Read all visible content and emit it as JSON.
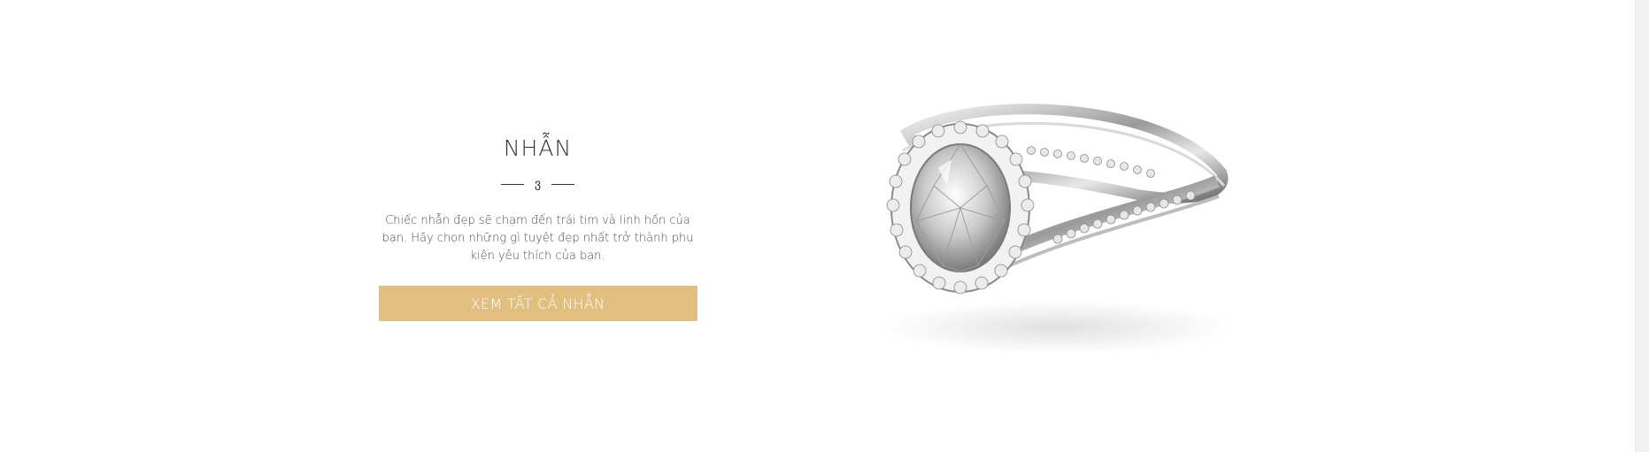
{
  "section": {
    "title": "NHẪN",
    "ornament": "ვ",
    "description": "Chiếc nhẫn đẹp sẽ chạm đến trái tim và linh hồn của bạn. Hãy chọn những gì tuyệt đẹp nhất trở thành phụ kiện yêu thích của bạn.",
    "cta_label": "XEM TẤT CẢ NHẪN"
  },
  "colors": {
    "accent": "#e0bf81",
    "title": "#333333",
    "text": "#4a4a4a",
    "background": "#ffffff"
  },
  "image": {
    "subject": "diamond-halo-ring"
  }
}
